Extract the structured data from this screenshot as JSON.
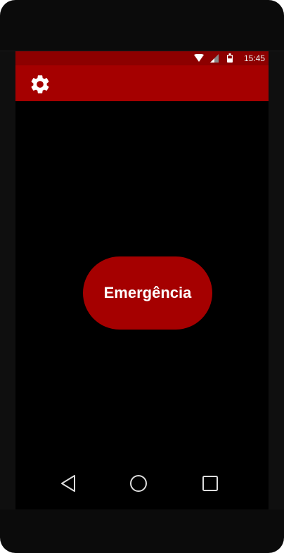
{
  "status_bar": {
    "time": "15:45",
    "icons": [
      "wifi-icon",
      "signal-icon",
      "battery-icon"
    ]
  },
  "app_bar": {
    "settings_icon": "gear-icon"
  },
  "main": {
    "emergency_label": "Emergência"
  },
  "nav_bar": {
    "icons": [
      "back-triangle-icon",
      "home-circle-icon",
      "recents-square-icon"
    ]
  },
  "colors": {
    "status_bar": "#8d0000",
    "app_bar": "#a50000",
    "button": "#a50000",
    "background": "#000000",
    "nav_icons": "#dddddd"
  }
}
